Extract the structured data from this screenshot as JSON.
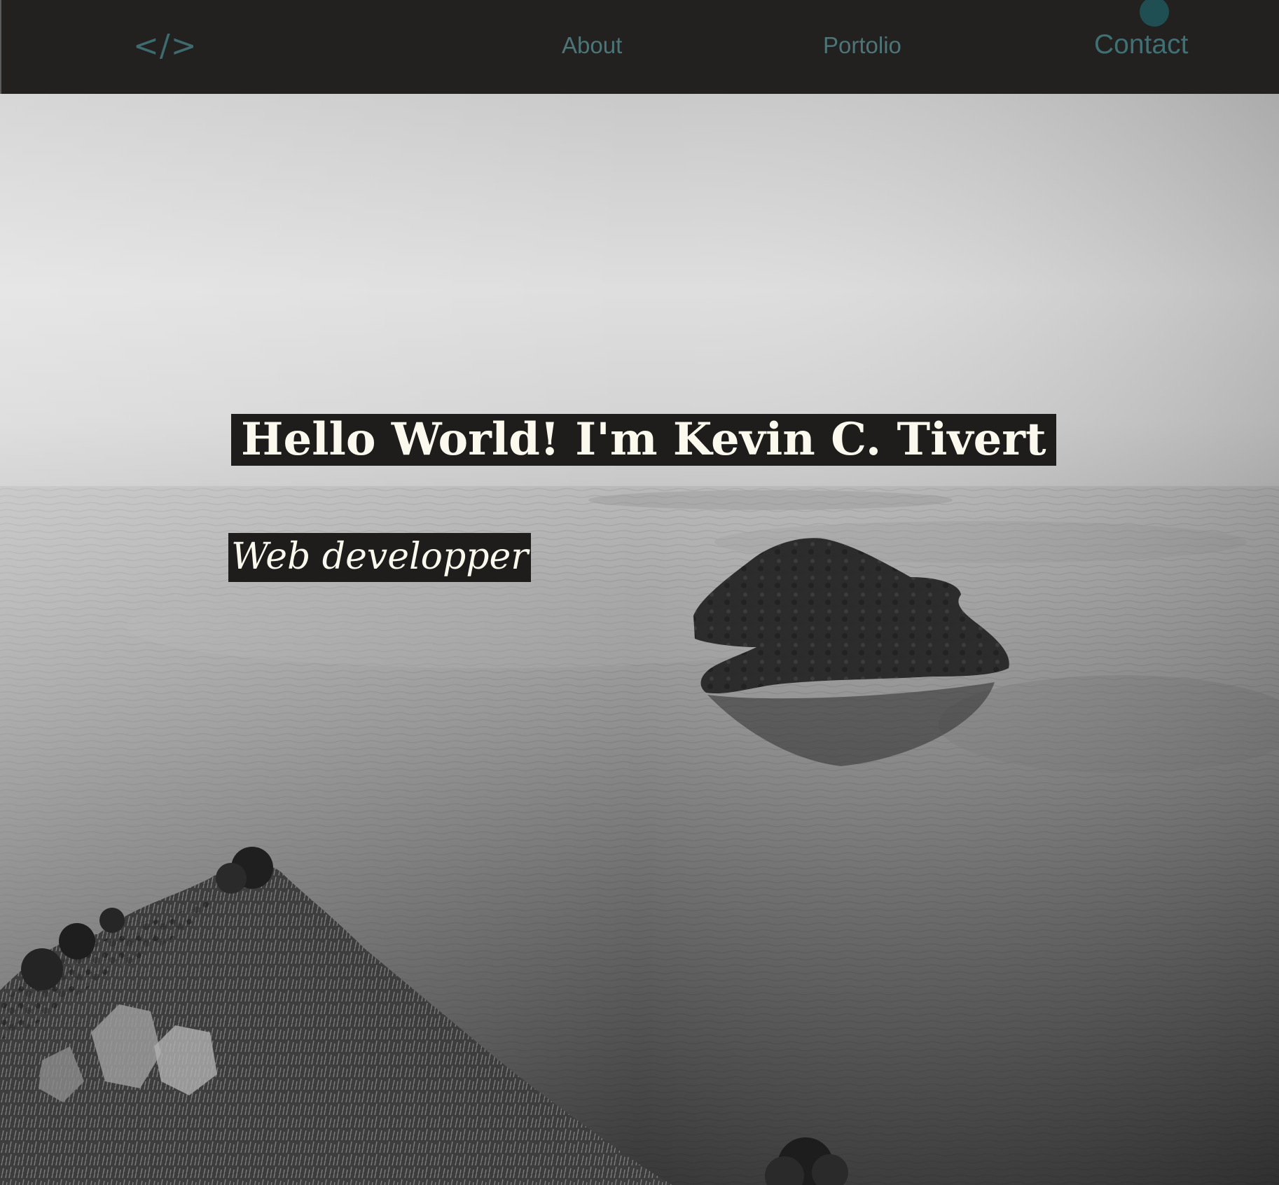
{
  "nav": {
    "logo": "</>",
    "links": [
      {
        "label": "About"
      },
      {
        "label": "Portolio"
      },
      {
        "label": "Contact"
      }
    ]
  },
  "hero": {
    "headline": "Hello World! I'm  Kevin C. Tivert",
    "subtitle": "Web developper",
    "background_image": "black-and-white-lake-with-island"
  },
  "colors": {
    "nav_background": "#222120",
    "nav_text": "#4d7577",
    "accent_dot": "#1f4f52",
    "label_background": "#1e1d1b",
    "label_text": "#fbf8ee"
  }
}
